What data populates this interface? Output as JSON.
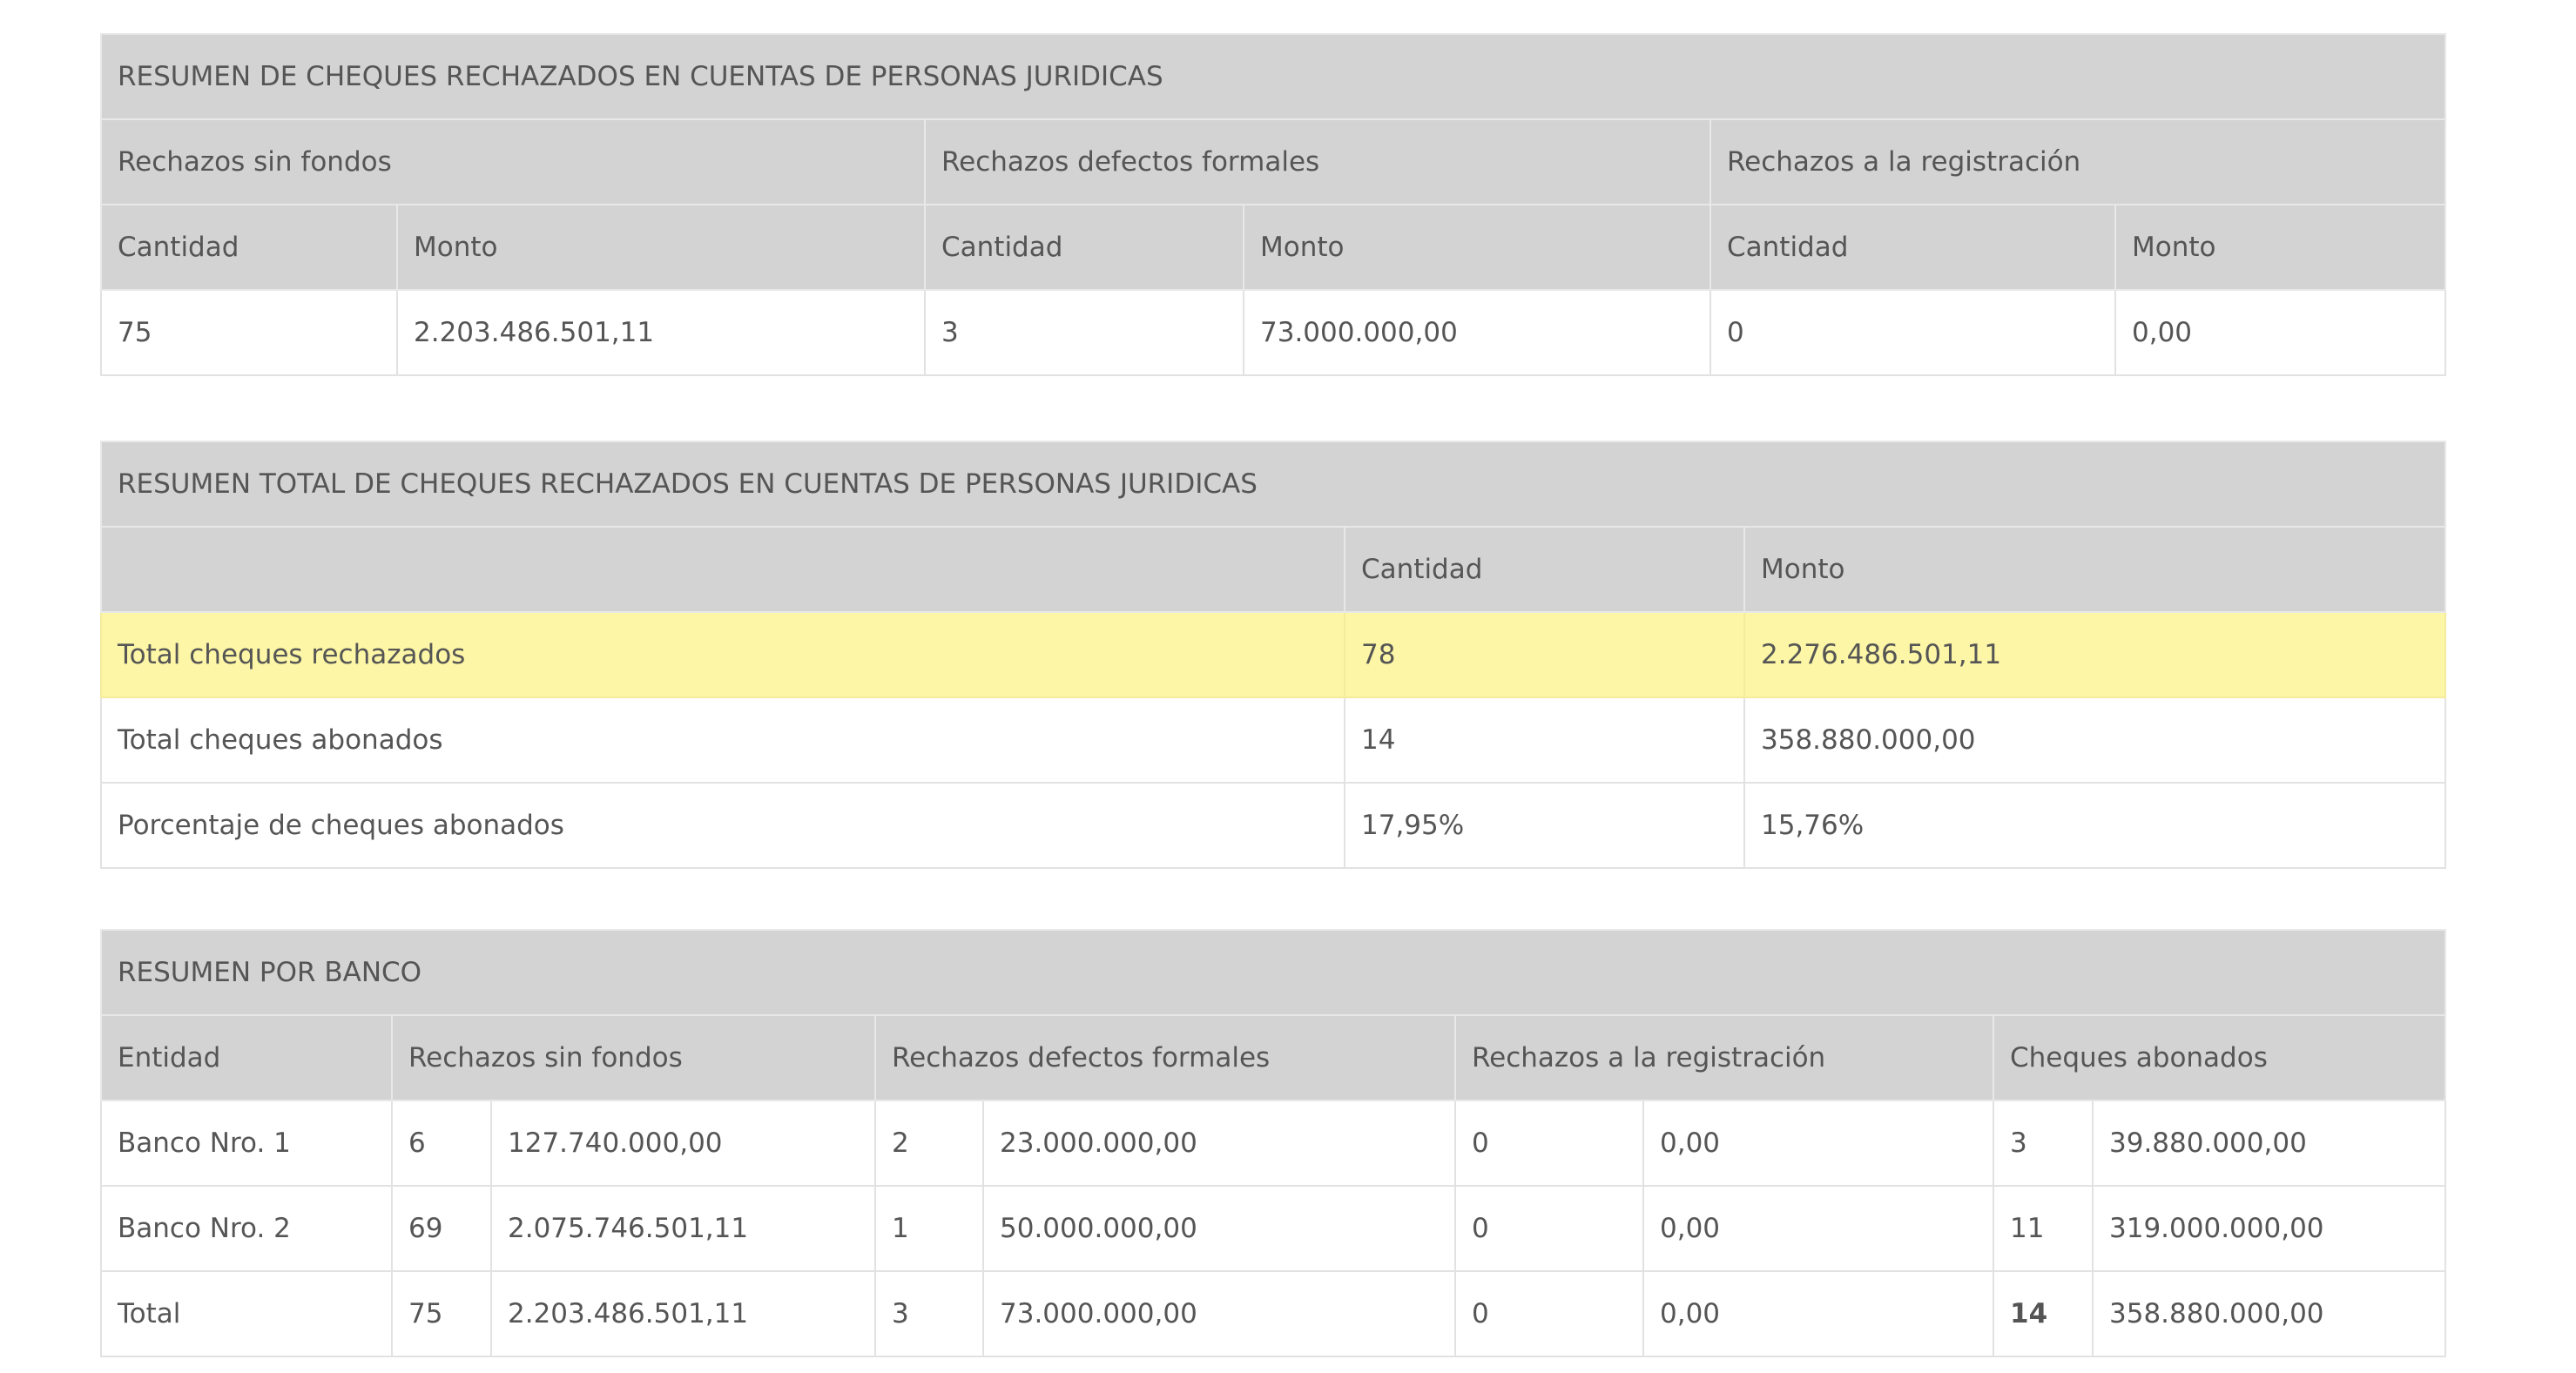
{
  "juridicas": {
    "title": "RESUMEN DE CHEQUES RECHAZADOS EN CUENTAS DE PERSONAS JURIDICAS",
    "groups": {
      "sin_fondos": "Rechazos sin fondos",
      "defectos": "Rechazos defectos formales",
      "registracion": "Rechazos a la registración"
    },
    "col_cantidad": "Cantidad",
    "col_monto": "Monto",
    "row": {
      "sin_fondos_cantidad": "75",
      "sin_fondos_monto": "2.203.486.501,11",
      "defectos_cantidad": "3",
      "defectos_monto": "73.000.000,00",
      "registracion_cantidad": "0",
      "registracion_monto": "0,00"
    }
  },
  "total": {
    "title": "RESUMEN TOTAL DE CHEQUES RECHAZADOS EN CUENTAS DE PERSONAS JURIDICAS",
    "col_cantidad": "Cantidad",
    "col_monto": "Monto",
    "highlight_color": "#fdf6a6",
    "rows": [
      {
        "label": "Total cheques rechazados",
        "cantidad": "78",
        "monto": "2.276.486.501,11"
      },
      {
        "label": "Total cheques abonados",
        "cantidad": "14",
        "monto": "358.880.000,00"
      },
      {
        "label": "Porcentaje de cheques abonados",
        "cantidad": "17,95%",
        "monto": "15,76%"
      }
    ]
  },
  "banco": {
    "title": "RESUMEN POR BANCO",
    "headers": {
      "entidad": "Entidad",
      "sin_fondos": "Rechazos sin fondos",
      "defectos": "Rechazos defectos formales",
      "registracion": "Rechazos a la registración",
      "abonados": "Cheques abonados"
    },
    "rows": [
      {
        "entidad": "Banco Nro. 1",
        "sf_cant": "6",
        "sf_monto": "127.740.000,00",
        "df_cant": "2",
        "df_monto": "23.000.000,00",
        "rr_cant": "0",
        "rr_monto": "0,00",
        "ab_cant": "3",
        "ab_monto": "39.880.000,00"
      },
      {
        "entidad": "Banco Nro. 2",
        "sf_cant": "69",
        "sf_monto": "2.075.746.501,11",
        "df_cant": "1",
        "df_monto": "50.000.000,00",
        "rr_cant": "0",
        "rr_monto": "0,00",
        "ab_cant": "11",
        "ab_monto": "319.000.000,00"
      },
      {
        "entidad": "Total",
        "sf_cant": "75",
        "sf_monto": "2.203.486.501,11",
        "df_cant": "3",
        "df_monto": "73.000.000,00",
        "rr_cant": "0",
        "rr_monto": "0,00",
        "ab_cant": "14",
        "ab_monto": "358.880.000,00"
      }
    ]
  }
}
